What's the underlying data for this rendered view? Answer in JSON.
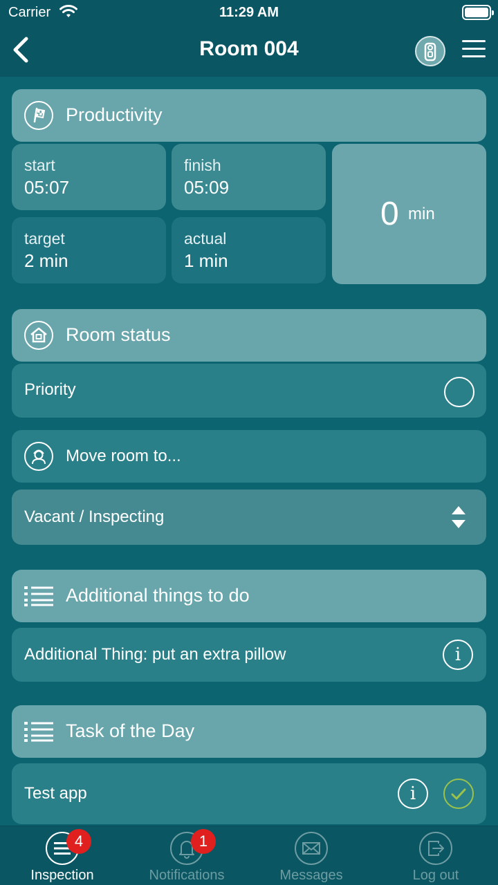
{
  "status_bar": {
    "carrier": "Carrier",
    "time": "11:29 AM"
  },
  "nav": {
    "title": "Room 004"
  },
  "productivity": {
    "header": "Productivity",
    "start_label": "start",
    "start_value": "05:07",
    "finish_label": "finish",
    "finish_value": "05:09",
    "target_label": "target",
    "target_value": "2 min",
    "actual_label": "actual",
    "actual_value": "1 min",
    "elapsed_value": "0",
    "elapsed_unit": "min"
  },
  "room_status": {
    "header": "Room status",
    "priority_label": "Priority",
    "move_label": "Move room to...",
    "selected_status": "Vacant / Inspecting"
  },
  "additional": {
    "header": "Additional things to do",
    "item": "Additional Thing: put an extra pillow",
    "info": "i"
  },
  "task_of_day": {
    "header": "Task of the Day",
    "item": "Test app",
    "info": "i"
  },
  "tabs": [
    {
      "label": "Inspection",
      "badge": "4",
      "icon": "list-icon"
    },
    {
      "label": "Notifications",
      "badge": "1",
      "icon": "bell-icon"
    },
    {
      "label": "Messages",
      "badge": "",
      "icon": "envelope-icon"
    },
    {
      "label": "Log out",
      "badge": "",
      "icon": "logout-icon"
    }
  ],
  "colors": {
    "background": "#0b6470",
    "header_bar": "#0a5662",
    "section_header": "#69a6ab",
    "row": "#2a8088",
    "badge": "#e0201e",
    "check": "#9bc24a"
  }
}
